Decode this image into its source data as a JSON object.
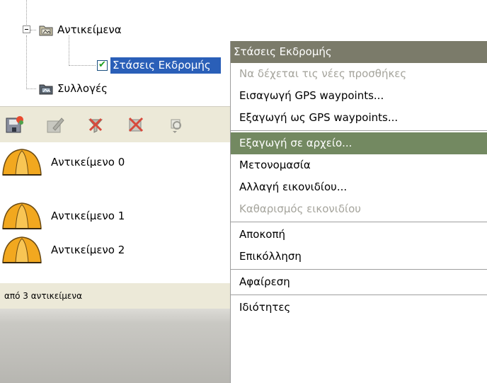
{
  "tree": {
    "items": [
      {
        "label": "Αντικείμενα",
        "icon": "folder-icon"
      },
      {
        "label": "Στάσεις Εκδρομής",
        "checked": true,
        "icon": "checkbox-checked-icon"
      },
      {
        "label": "Συλλογές",
        "icon": "collection-folder-icon"
      }
    ]
  },
  "toolbar": {
    "buttons": [
      "save-icon",
      "edit-icon",
      "delete-filter-icon",
      "delete-icon",
      "export-icon"
    ]
  },
  "list": {
    "items": [
      {
        "label": "Αντικείμενο 0",
        "icon": "tent-icon"
      },
      {
        "label": "Αντικείμενο 1",
        "icon": "tent-icon"
      },
      {
        "label": "Αντικείμενο 2",
        "icon": "tent-icon"
      }
    ]
  },
  "status": {
    "text": "από 3 αντικείμενα"
  },
  "menu": {
    "header": "Στάσεις Εκδρομής",
    "items": [
      {
        "label": "Να δέχεται τις νέες προσθήκες",
        "disabled": true
      },
      {
        "label": "Εισαγωγή GPS waypoints..."
      },
      {
        "label": "Εξαγωγή ως GPS waypoints..."
      },
      {
        "label": "Εξαγωγή σε αρχείο...",
        "highlighted": true
      },
      {
        "label": "Μετονομασία"
      },
      {
        "label": "Αλλαγή εικονιδίου..."
      },
      {
        "label": "Καθαρισμός εικονιδίου",
        "disabled": true
      },
      {
        "label": "Αποκοπή"
      },
      {
        "label": "Επικόλληση"
      },
      {
        "label": "Αφαίρεση"
      },
      {
        "label": "Ιδιότητες"
      }
    ]
  },
  "colors": {
    "menu_header": "#7b7b6a",
    "menu_highlight": "#738961",
    "selection": "#2a5fb8",
    "tent": "#f2a81f",
    "panel": "#ece9d8"
  }
}
